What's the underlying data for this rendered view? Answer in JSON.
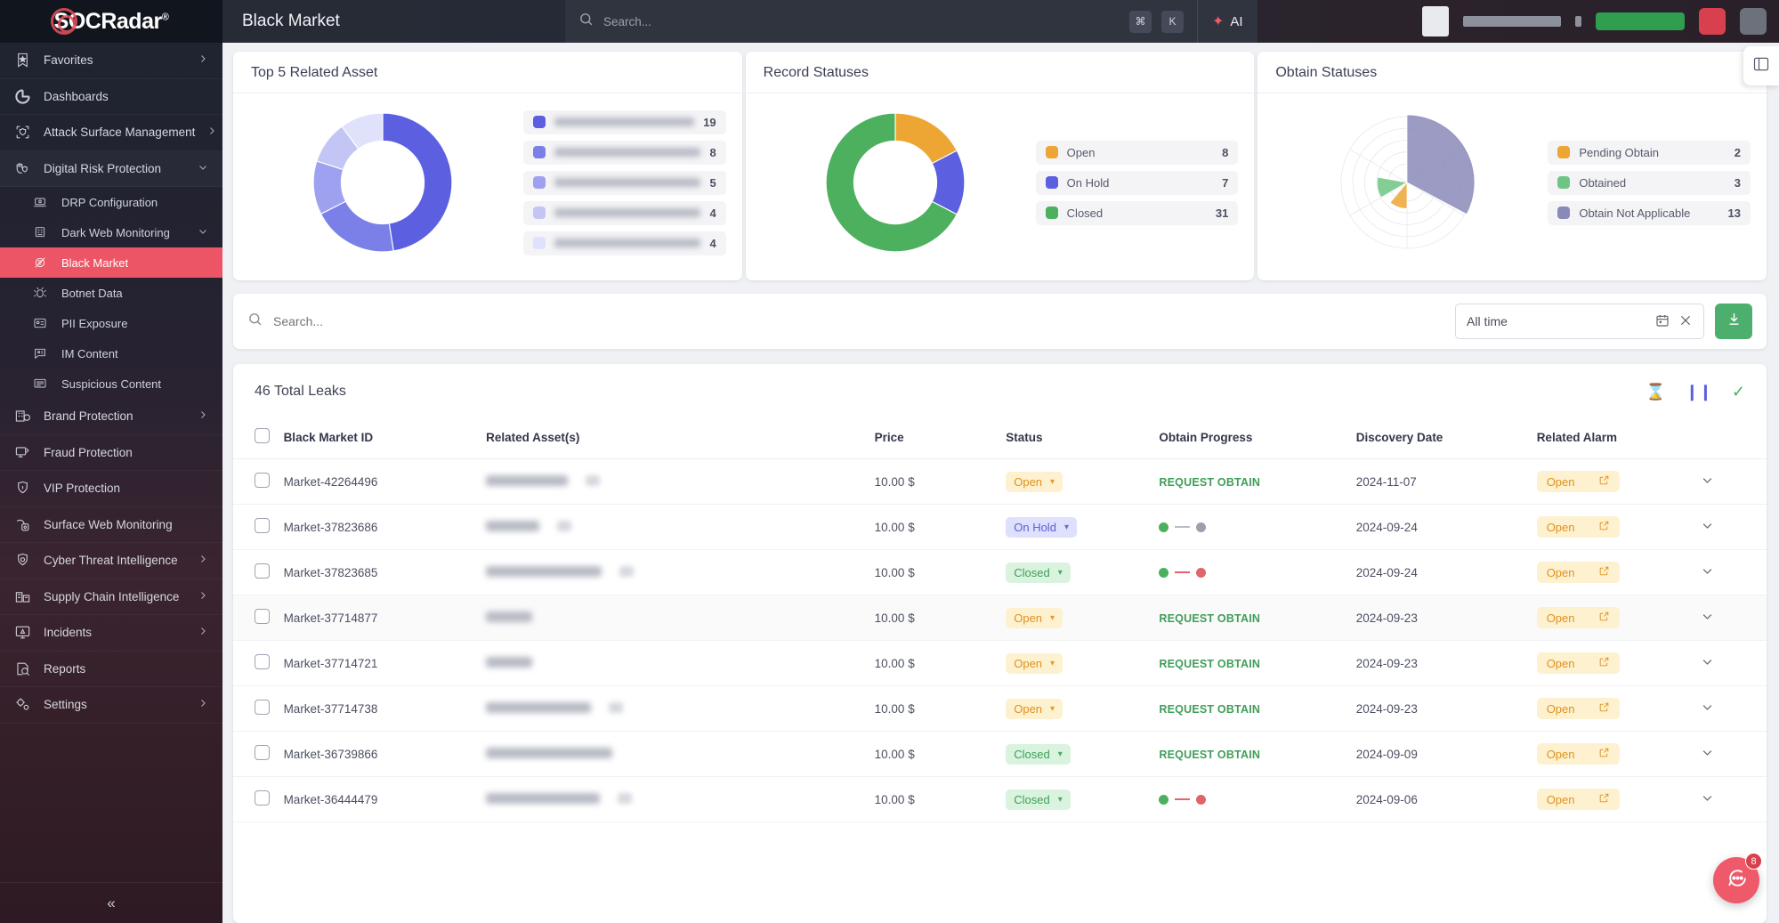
{
  "brand": {
    "name": "SOCRadar",
    "registered": "®"
  },
  "header": {
    "page_title": "Black Market",
    "search_placeholder": "Search...",
    "kbd_cmd": "⌘",
    "kbd_key": "K",
    "ai_label": "AI"
  },
  "sidebar": {
    "items": [
      {
        "label": "Favorites",
        "icon": "bookmark-star-icon",
        "chevron": "right"
      },
      {
        "label": "Dashboards",
        "icon": "dashboard-icon",
        "chevron": ""
      },
      {
        "label": "Attack Surface Management",
        "icon": "shield-scan-icon",
        "chevron": "right"
      },
      {
        "label": "Digital Risk Protection",
        "icon": "hand-shield-icon",
        "chevron": "down",
        "open": true
      },
      {
        "label": "DRP Configuration",
        "icon": "laptop-config-icon",
        "sub": true
      },
      {
        "label": "Dark Web Monitoring",
        "icon": "dark-web-icon",
        "sub": true,
        "chevron": "down"
      },
      {
        "label": "Black Market",
        "icon": "black-market-icon",
        "sub": true,
        "active": true
      },
      {
        "label": "Botnet Data",
        "icon": "bug-icon",
        "sub": true
      },
      {
        "label": "PII Exposure",
        "icon": "id-card-icon",
        "sub": true
      },
      {
        "label": "IM Content",
        "icon": "chat-id-icon",
        "sub": true
      },
      {
        "label": "Suspicious Content",
        "icon": "suspicious-doc-icon",
        "sub": true
      },
      {
        "label": "Brand Protection",
        "icon": "brand-icon",
        "chevron": "right"
      },
      {
        "label": "Fraud Protection",
        "icon": "fraud-icon",
        "chevron": ""
      },
      {
        "label": "VIP Protection",
        "icon": "vip-icon",
        "chevron": ""
      },
      {
        "label": "Surface Web Monitoring",
        "icon": "surface-web-icon",
        "chevron": ""
      },
      {
        "label": "Cyber Threat Intelligence",
        "icon": "eye-shield-icon",
        "chevron": "right"
      },
      {
        "label": "Supply Chain Intelligence",
        "icon": "supply-chain-icon",
        "chevron": "right"
      },
      {
        "label": "Incidents",
        "icon": "incident-monitor-icon",
        "chevron": "right"
      },
      {
        "label": "Reports",
        "icon": "report-search-icon",
        "chevron": ""
      },
      {
        "label": "Settings",
        "icon": "gears-icon",
        "chevron": "right"
      }
    ],
    "collapse_label": "«"
  },
  "chart_data": [
    {
      "type": "pie",
      "title": "Top 5 Related Asset",
      "labels": [
        "",
        "",
        "",
        "",
        ""
      ],
      "labels_redacted": true,
      "values": [
        19,
        8,
        5,
        4,
        4
      ],
      "colors": [
        "#5b5fe0",
        "#7b7fe8",
        "#9ea1ef",
        "#c3c5f5",
        "#e0e1fb"
      ],
      "legend": "right",
      "donut": true
    },
    {
      "type": "pie",
      "title": "Record Statuses",
      "labels": [
        "Open",
        "On Hold",
        "Closed"
      ],
      "values": [
        8,
        7,
        31
      ],
      "colors": [
        "#eda634",
        "#5b5fe0",
        "#4cb05f"
      ],
      "legend": "right",
      "donut": true
    },
    {
      "type": "pie",
      "title": "Obtain Statuses",
      "subtype": "polar-rose",
      "labels": [
        "Pending Obtain",
        "Obtained",
        "Obtain Not Applicable"
      ],
      "values": [
        2,
        3,
        13
      ],
      "colors": [
        "#eda634",
        "#6fc684",
        "#8a8ab8"
      ],
      "legend": "right",
      "grid": true
    }
  ],
  "filter_bar": {
    "search_placeholder": "Search...",
    "date_range_value": "All time",
    "calendar_icon": "calendar-icon",
    "clear_icon": "close-icon",
    "download_icon": "download-icon"
  },
  "table": {
    "count_label": "46 Total Leaks",
    "actions": [
      {
        "name": "pending-hourglass-icon",
        "glyph": "⌛",
        "color": "#eda634"
      },
      {
        "name": "pause-icon",
        "glyph": "❙❙",
        "color": "#5b5fe0"
      },
      {
        "name": "check-icon",
        "glyph": "✓",
        "color": "#4cb05f"
      }
    ],
    "columns": [
      "Black Market ID",
      "Related Asset(s)",
      "Price",
      "Status",
      "Obtain Progress",
      "Discovery Date",
      "Related Alarm"
    ],
    "request_obtain_label": "REQUEST OBTAIN",
    "alarm_label": "Open",
    "rows": [
      {
        "id": "Market-42264496",
        "asset_w": 92,
        "asset_chip": true,
        "price": "10.00 $",
        "status": "Open",
        "status_kind": "open",
        "progress": "request",
        "date": "2024-11-07",
        "alarm": "Open"
      },
      {
        "id": "Market-37823686",
        "asset_w": 60,
        "asset_chip": true,
        "price": "10.00 $",
        "status": "On Hold",
        "status_kind": "hold",
        "progress": "green-gray",
        "date": "2024-09-24",
        "alarm": "Open"
      },
      {
        "id": "Market-37823685",
        "asset_w": 130,
        "asset_chip": true,
        "price": "10.00 $",
        "status": "Closed",
        "status_kind": "closed",
        "progress": "green-red",
        "date": "2024-09-24",
        "alarm": "Open"
      },
      {
        "id": "Market-37714877",
        "asset_w": 52,
        "asset_chip": false,
        "price": "10.00 $",
        "status": "Open",
        "status_kind": "open",
        "progress": "request",
        "date": "2024-09-23",
        "alarm": "Open",
        "alt": true
      },
      {
        "id": "Market-37714721",
        "asset_w": 52,
        "asset_chip": false,
        "price": "10.00 $",
        "status": "Open",
        "status_kind": "open",
        "progress": "request",
        "date": "2024-09-23",
        "alarm": "Open"
      },
      {
        "id": "Market-37714738",
        "asset_w": 118,
        "asset_chip": true,
        "price": "10.00 $",
        "status": "Open",
        "status_kind": "open",
        "progress": "request",
        "date": "2024-09-23",
        "alarm": "Open"
      },
      {
        "id": "Market-36739866",
        "asset_w": 142,
        "asset_chip": false,
        "price": "10.00 $",
        "status": "Closed",
        "status_kind": "closed",
        "progress": "request",
        "date": "2024-09-09",
        "alarm": "Open"
      },
      {
        "id": "Market-36444479",
        "asset_w": 128,
        "asset_chip": true,
        "price": "10.00 $",
        "status": "Closed",
        "status_kind": "closed",
        "progress": "green-red",
        "date": "2024-09-06",
        "alarm": "Open"
      }
    ]
  },
  "floating": {
    "side_tab_icon": "panel-icon",
    "chat_icon": "chat-icon",
    "chat_badge": "8"
  }
}
